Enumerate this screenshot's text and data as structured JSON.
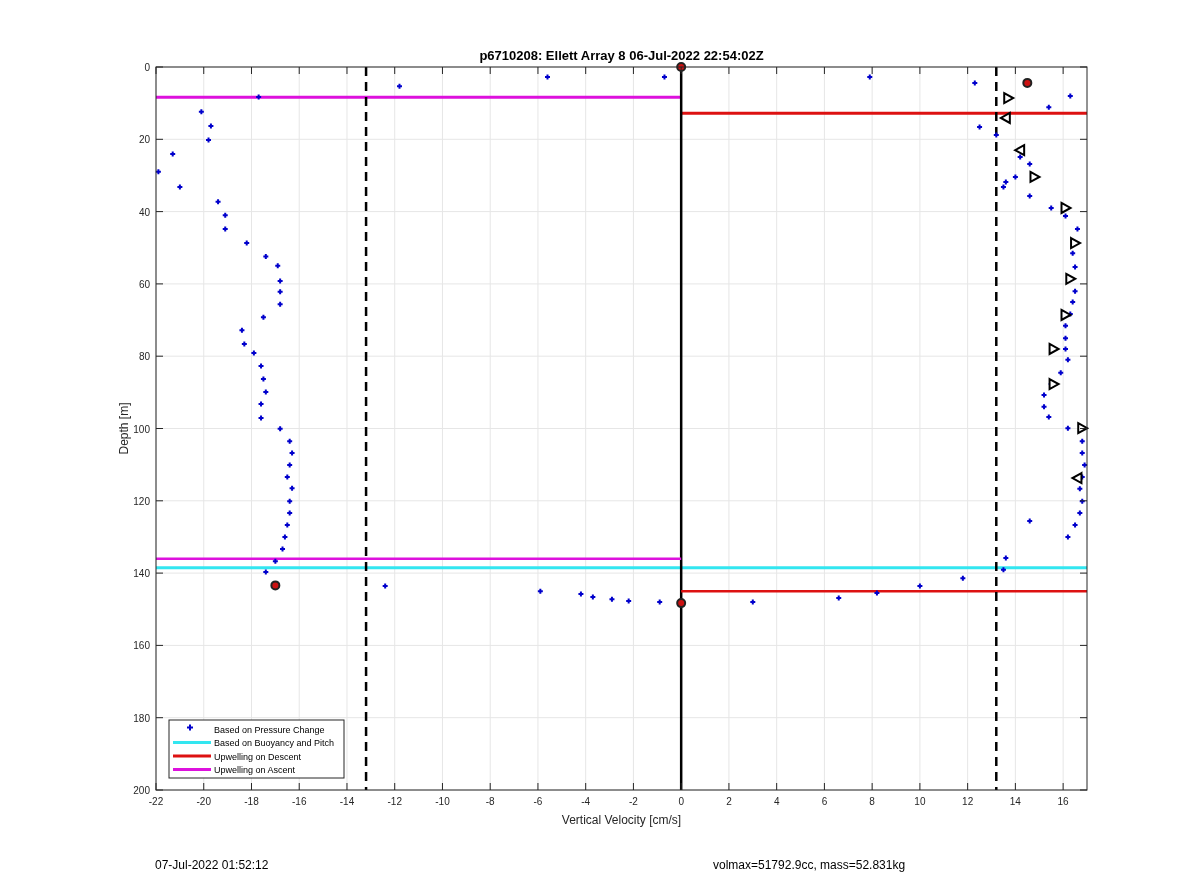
{
  "figure": {
    "chart_data": {
      "type": "scatter",
      "title": "p6710208: Ellett Array 8 06-Jul-2022 22:54:02Z",
      "xlabel": "Vertical Velocity [cm/s]",
      "ylabel": "Depth [m]",
      "xlim": [
        -22,
        17
      ],
      "ylim": [
        200,
        0
      ],
      "xticks": [
        -22,
        -20,
        -18,
        -16,
        -14,
        -12,
        -10,
        -8,
        -6,
        -4,
        -2,
        0,
        2,
        4,
        6,
        8,
        10,
        12,
        14,
        16
      ],
      "yticks": [
        0,
        20,
        40,
        60,
        80,
        100,
        120,
        140,
        160,
        180,
        200
      ],
      "grid": true,
      "legend": true,
      "series": [
        {
          "name": "Based on Pressure Change",
          "color": "#0000cc",
          "x": [
            -21.9,
            -21.3,
            -21.0,
            -20.1,
            -19.7,
            -19.8,
            -19.4,
            -19.1,
            -19.1,
            -18.2,
            -17.4,
            -16.9,
            -16.8,
            -16.8,
            -16.8,
            -17.5,
            -18.4,
            -18.3,
            -17.9,
            -17.6,
            -17.5,
            -17.4,
            -17.6,
            -17.6,
            -16.8,
            -16.4,
            -16.3,
            -16.4,
            -16.5,
            -16.3,
            -16.4,
            -16.4,
            -16.5,
            -16.6,
            -16.7,
            -17.0,
            -17.4,
            -17.7,
            -11.8,
            -5.6,
            -0.7,
            7.9,
            12.3,
            16.3,
            15.4,
            12.5,
            13.2,
            14.2,
            14.6,
            14.0,
            13.6,
            13.5,
            14.6,
            15.5,
            16.1,
            16.6,
            16.4,
            16.5,
            16.5,
            16.4,
            16.3,
            16.1,
            16.1,
            16.1,
            16.2,
            15.9,
            15.5,
            15.2,
            15.2,
            15.4,
            16.2,
            16.8,
            16.8,
            16.9,
            16.8,
            16.7,
            16.8,
            16.7,
            16.5,
            16.2,
            14.6,
            13.6,
            13.5,
            11.8,
            10.0,
            8.2,
            6.6,
            3.0,
            -12.4,
            -5.9,
            -4.2,
            -3.7,
            -2.9,
            -2.2,
            -0.9
          ],
          "values": [
            29,
            24.1,
            33.2,
            12.4,
            16.3,
            20.2,
            37.3,
            41,
            44.8,
            48.7,
            52.4,
            55,
            59.2,
            62.2,
            65.6,
            69.2,
            72.8,
            76.6,
            79.1,
            82.7,
            86.3,
            89.9,
            93.2,
            97.1,
            100.1,
            103.5,
            106.8,
            110.1,
            113.4,
            116.5,
            120.1,
            123.4,
            126.7,
            130,
            133.3,
            136.7,
            139.7,
            8.3,
            5.3,
            2.8,
            2.8,
            2.8,
            4.4,
            8.0,
            11.1,
            16.6,
            18.8,
            24.9,
            26.8,
            30.4,
            31.8,
            33.2,
            35.7,
            39,
            41.2,
            44.8,
            51.5,
            55.3,
            62,
            65,
            68.3,
            71.6,
            75,
            78,
            81,
            84.6,
            87.7,
            90.7,
            94,
            96.8,
            99.9,
            103.5,
            106.8,
            110.1,
            113.4,
            116.7,
            120.1,
            123.4,
            126.7,
            130,
            125.6,
            135.8,
            139.1,
            141.4,
            143.6,
            145.5,
            146.9,
            148,
            143.6,
            145,
            145.8,
            146.6,
            147.2,
            147.7,
            148
          ]
        },
        {
          "name": "Based on Buoyancy and Pitch",
          "type": "line",
          "color": "#33e6f0",
          "x": [
            -22,
            17
          ],
          "values": [
            138.5,
            138.5
          ]
        },
        {
          "name": "Upwelling on Descent",
          "type": "line",
          "color": "#dd1111",
          "x": [
            0,
            17
          ],
          "values": [
            12.8,
            12.8
          ]
        },
        {
          "name": "Upwelling on Ascent",
          "type": "line",
          "color": "#dd11dd",
          "x": [
            -22,
            0
          ],
          "values": [
            8.4,
            8.4
          ]
        },
        {
          "color": "#000000",
          "x": [
            13.7,
            14.8,
            16.1,
            16.5,
            16.3,
            16.1,
            15.6,
            15.6,
            16.8
          ],
          "values": [
            8.6,
            30.4,
            39,
            48.7,
            58.6,
            68.6,
            78,
            87.7,
            99.9
          ]
        },
        {
          "color": "#000000",
          "x": [
            13.6,
            14.2,
            16.6
          ],
          "values": [
            14.1,
            23,
            113.7
          ]
        },
        {
          "color": "#cc1111",
          "x": [
            14.5,
            -17.0,
            0,
            0
          ],
          "values": [
            4.4,
            143.4,
            148.3,
            0
          ]
        },
        {
          "type": "line",
          "color": "#000000",
          "x": [
            0,
            0
          ],
          "values": [
            0,
            200
          ]
        },
        {
          "type": "line",
          "color": "#000000",
          "line_style": "dashed",
          "x": [
            -13.2,
            -13.2
          ],
          "values": [
            0,
            200
          ]
        },
        {
          "type": "line",
          "color": "#dd1111",
          "x": [
            0,
            17
          ],
          "values": [
            145,
            145
          ]
        },
        {
          "type": "line",
          "color": "#dd11dd",
          "x": [
            -22,
            0
          ],
          "values": [
            136,
            136
          ]
        },
        {
          "type": "line",
          "color": "#000000",
          "line_style": "dashed",
          "x": [
            13.2,
            13.2
          ],
          "values": [
            0,
            200
          ]
        }
      ]
    }
  },
  "footer": {
    "timestamp": "07-Jul-2022 01:52:12",
    "summary": "volmax=51792.9cc, mass=52.831kg"
  }
}
